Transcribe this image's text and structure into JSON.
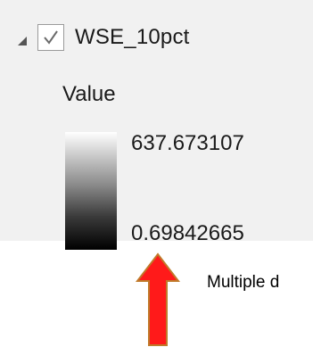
{
  "layer": {
    "expanded": true,
    "checked": true,
    "name": "WSE_10pct"
  },
  "legend": {
    "field_label": "Value",
    "max_value": "637.673107",
    "min_value": "0.69842665",
    "ramp_colors": [
      "#ffffff",
      "#000000"
    ]
  },
  "annotation": {
    "text": "Multiple d",
    "arrow_fill": "#ff1a1a",
    "arrow_stroke": "#c07a2a"
  }
}
